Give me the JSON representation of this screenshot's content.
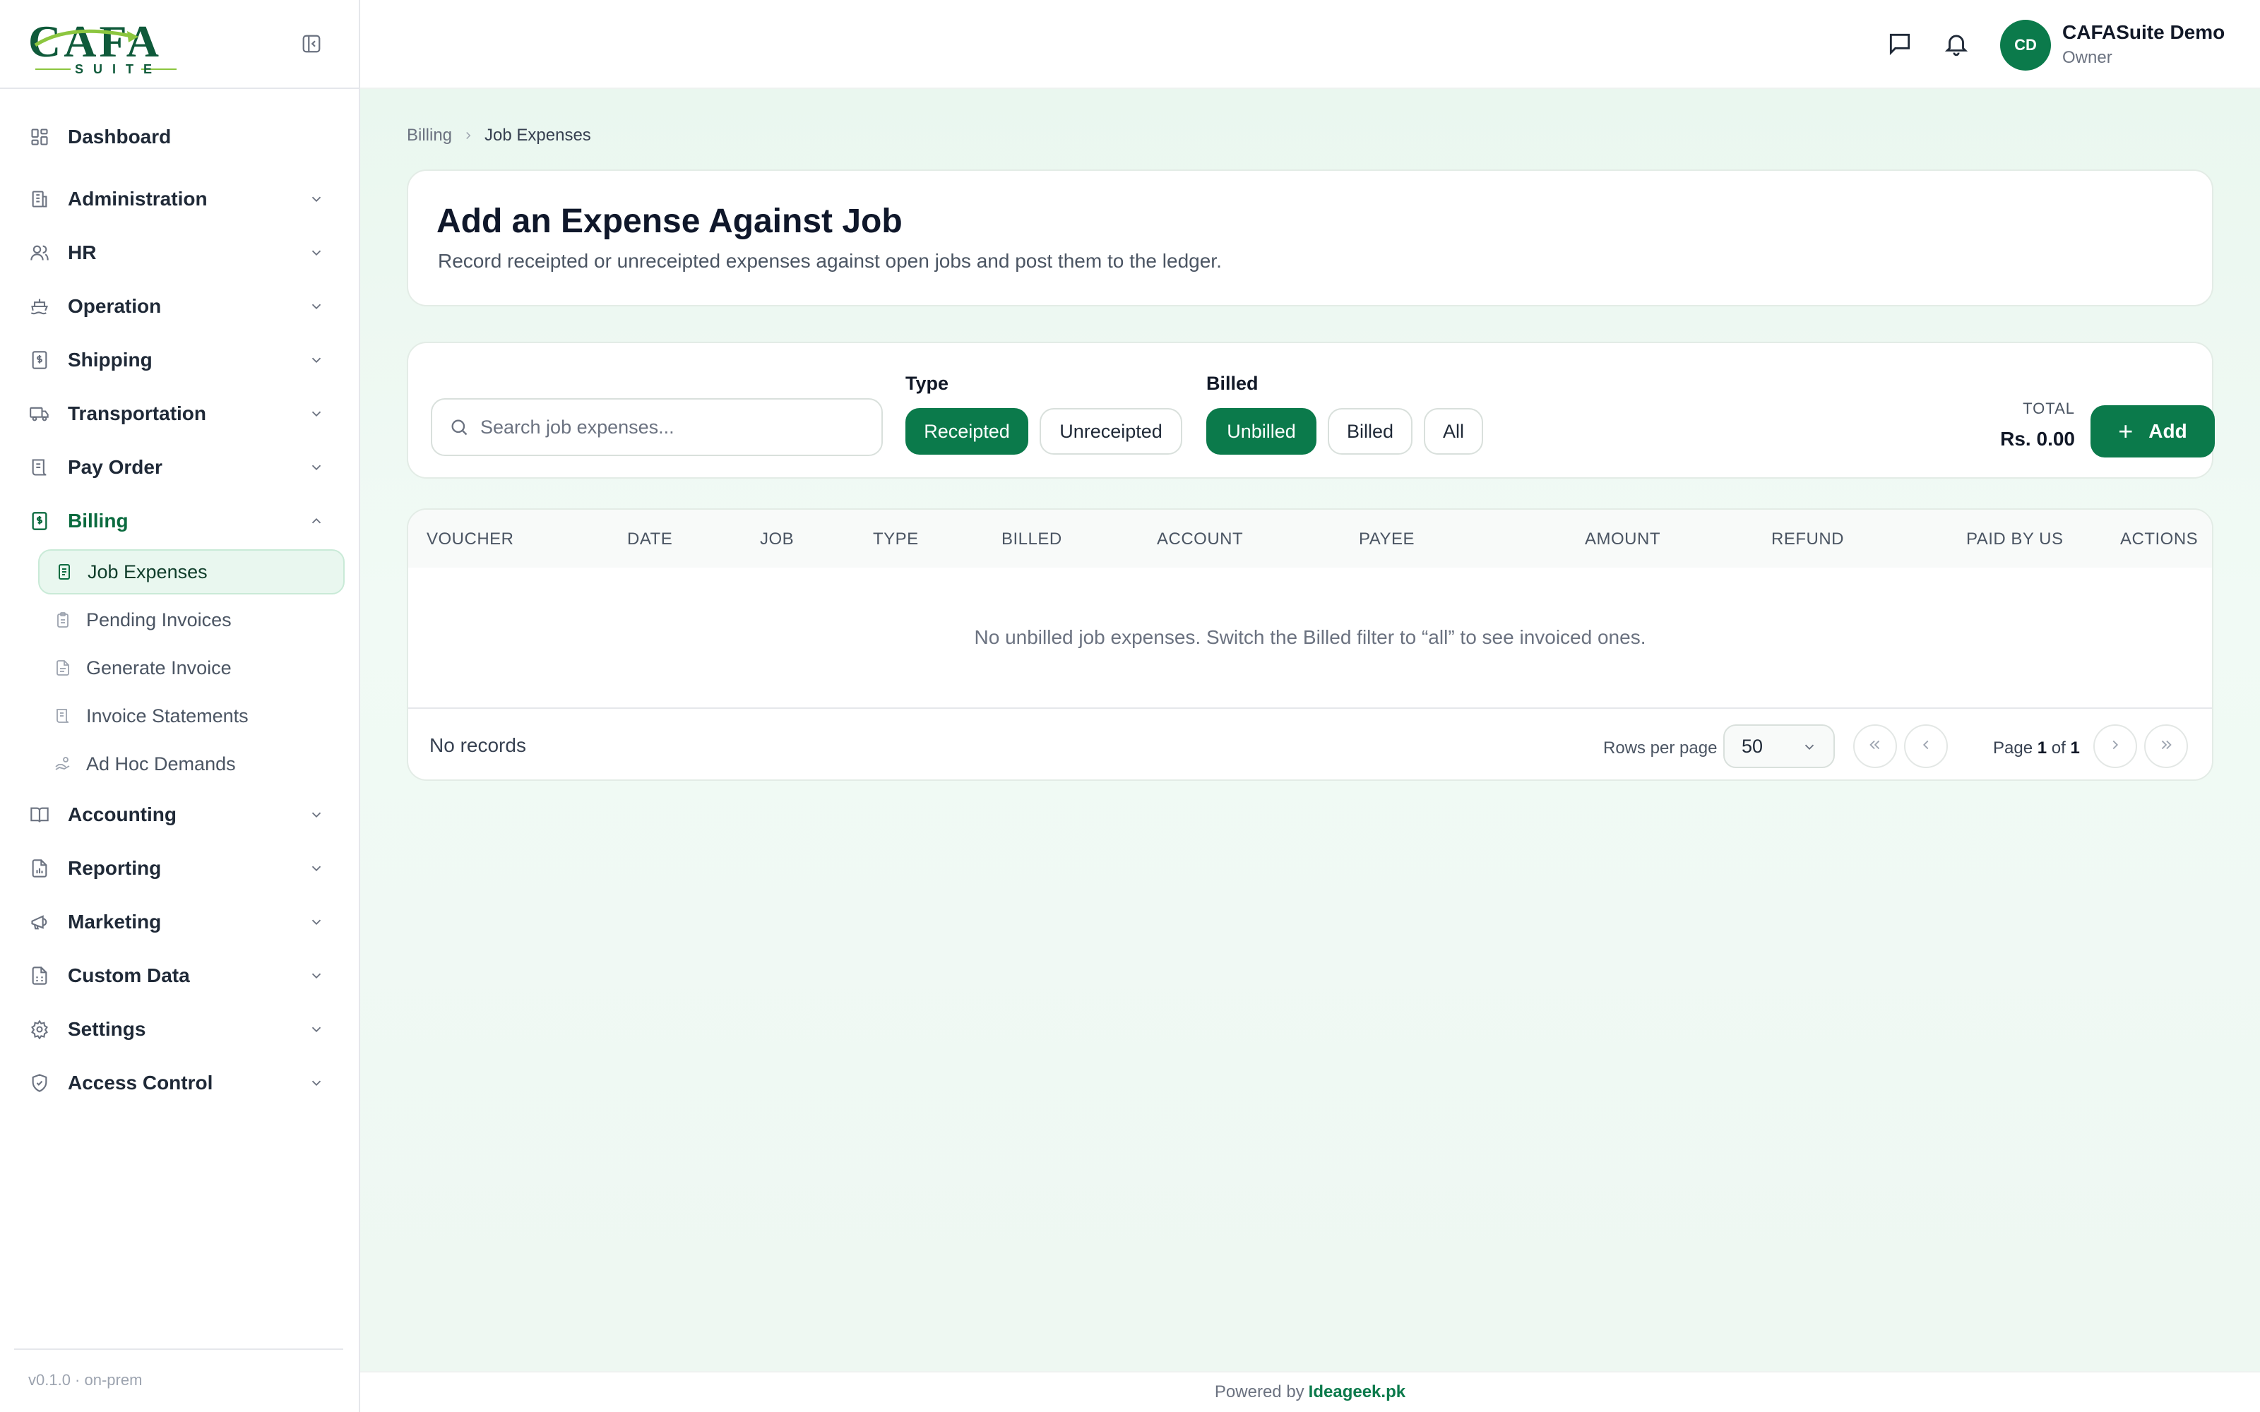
{
  "brand": {
    "logo_text": "CAFA",
    "logo_sub": "SUITE",
    "accent": "#0b7a4b",
    "accent_light": "#e9f7ef"
  },
  "sidebar": {
    "items": [
      {
        "label": "Dashboard",
        "icon": "dashboard-icon"
      },
      {
        "label": "Administration",
        "icon": "building-icon"
      },
      {
        "label": "HR",
        "icon": "users-icon"
      },
      {
        "label": "Operation",
        "icon": "ship-icon"
      },
      {
        "label": "Shipping",
        "icon": "document-dollar-icon"
      },
      {
        "label": "Transportation",
        "icon": "truck-icon"
      },
      {
        "label": "Pay Order",
        "icon": "receipt-icon"
      },
      {
        "label": "Billing",
        "icon": "billing-icon"
      },
      {
        "label": "Accounting",
        "icon": "book-icon"
      },
      {
        "label": "Reporting",
        "icon": "report-icon"
      },
      {
        "label": "Marketing",
        "icon": "megaphone-icon"
      },
      {
        "label": "Custom Data",
        "icon": "database-icon"
      },
      {
        "label": "Settings",
        "icon": "gear-icon"
      },
      {
        "label": "Access Control",
        "icon": "shield-icon"
      }
    ],
    "billing_sub": [
      {
        "label": "Job Expenses",
        "icon": "file-text-icon"
      },
      {
        "label": "Pending Invoices",
        "icon": "clipboard-icon"
      },
      {
        "label": "Generate Invoice",
        "icon": "file-icon"
      },
      {
        "label": "Invoice Statements",
        "icon": "scroll-icon"
      },
      {
        "label": "Ad Hoc Demands",
        "icon": "hand-coins-icon"
      }
    ],
    "version": "v0.1.0 · on-prem"
  },
  "topbar": {
    "avatar_initials": "CD",
    "user_name": "CAFASuite Demo",
    "user_role": "Owner"
  },
  "breadcrumb": {
    "parent": "Billing",
    "current": "Job Expenses"
  },
  "hero": {
    "title": "Add an Expense Against Job",
    "subtitle": "Record receipted or unreceipted expenses against open jobs and post them to the ledger."
  },
  "filters": {
    "search_placeholder": "Search job expenses...",
    "type_label": "Type",
    "type_options": [
      "Receipted",
      "Unreceipted"
    ],
    "type_selected": "Receipted",
    "billed_label": "Billed",
    "billed_options": [
      "Unbilled",
      "Billed",
      "All"
    ],
    "billed_selected": "Unbilled",
    "total_label": "TOTAL",
    "total_value": "Rs. 0.00",
    "add_label": "Add"
  },
  "table": {
    "columns": [
      "VOUCHER",
      "DATE",
      "JOB",
      "TYPE",
      "BILLED",
      "ACCOUNT",
      "PAYEE",
      "AMOUNT",
      "REFUND",
      "PAID BY US",
      "ACTIONS"
    ],
    "empty_message": "No unbilled job expenses. Switch the Billed filter to “all” to see invoiced ones.",
    "records_text": "No records",
    "rows_per_page_label": "Rows per page",
    "rows_per_page": "50",
    "page_word": "Page",
    "page_current": "1",
    "page_of": "of",
    "page_total": "1"
  },
  "footer": {
    "powered_by": "Powered by",
    "company": "Ideageek.pk"
  }
}
